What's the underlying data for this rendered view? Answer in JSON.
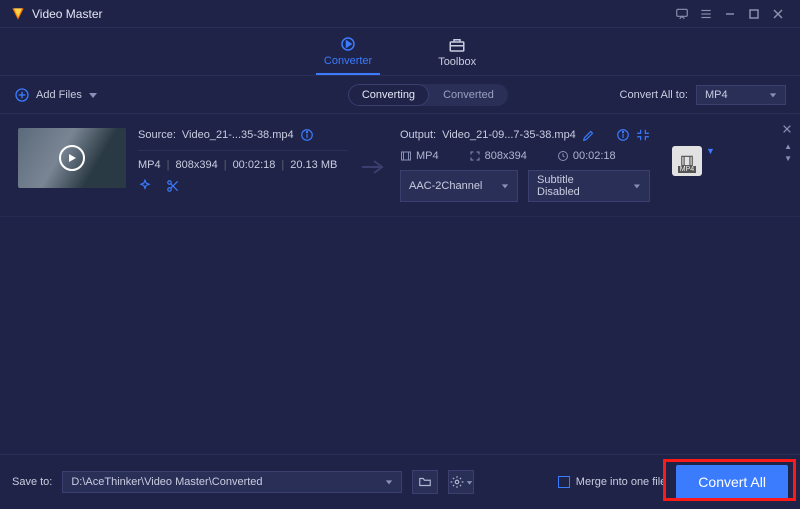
{
  "app": {
    "title": "Video Master"
  },
  "topnav": {
    "converter": "Converter",
    "toolbox": "Toolbox",
    "active": "converter"
  },
  "subbar": {
    "add_files": "Add Files",
    "converting": "Converting",
    "converted": "Converted",
    "convert_all_to_label": "Convert All to:",
    "convert_all_to_value": "MP4"
  },
  "item": {
    "source_label": "Source:",
    "source_file": "Video_21-...35-38.mp4",
    "format": "MP4",
    "resolution": "808x394",
    "duration": "00:02:18",
    "size": "20.13 MB",
    "output_label": "Output:",
    "output_file": "Video_21-09...7-35-38.mp4",
    "out_format": "MP4",
    "out_resolution": "808x394",
    "out_duration": "00:02:18",
    "audio_select": "AAC-2Channel",
    "subtitle_select": "Subtitle Disabled",
    "out_badge": "MP4"
  },
  "bottom": {
    "save_to_label": "Save to:",
    "save_to_path": "D:\\AceThinker\\Video Master\\Converted",
    "merge_label": "Merge into one file",
    "convert_label": "Convert All"
  }
}
